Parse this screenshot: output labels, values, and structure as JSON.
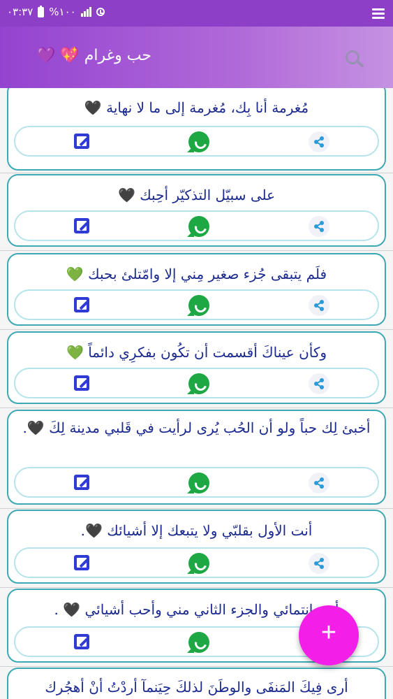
{
  "status_bar": {
    "time": "٠٣:٣٧",
    "battery_text": "%١٠٠",
    "battery_icon": "battery-full-icon",
    "signal_icon": "signal-icon",
    "alarm_icon": "alarm-icon",
    "menu_icon": "menu-icon"
  },
  "app_bar": {
    "title": "حب وغرام 💖 💜",
    "search_icon": "search-icon"
  },
  "cards": [
    {
      "text": "مُغرمة أنا بِك، مُغرمة إلى ما لا نهاية 🖤"
    },
    {
      "text": "على سبيّل التذكيّر أحِبك 🖤"
    },
    {
      "text": "فلَم يتبقى جُزء صغير مِني إلا وامّتلئ بحبك 💚"
    },
    {
      "text": "وكأن عيناكَ أقسمت أن تكُون بفكرِي دائماً 💚"
    },
    {
      "text": "أخبئ لِك حباً ولو أن الحُب يُرى لرأيت في قَلبي مدينة لِكَ 🖤."
    },
    {
      "text": "أنت الأول بقلبّي ولا يتبعك إلا أشيائك 🖤."
    },
    {
      "text": "أنت إنتمائي والجزء الثاني مني وأحب أشيائي 🖤 ."
    },
    {
      "text": "أرى فِيكَ المَنفَى والوطَنَ لذلكَ حِيَنمآ أردْتُ أنْ أهجُرك"
    }
  ],
  "actions": {
    "edit_icon": "edit-icon",
    "whatsapp_icon": "whatsapp-icon",
    "share_icon": "share-icon"
  },
  "fab": {
    "label": "+"
  },
  "colors": {
    "status_bar": "#8e3fc7",
    "app_bar_start": "#9443d0",
    "app_bar_end": "#c592e2",
    "card_border": "#3ea8b4",
    "text": "#1b2a8e",
    "fab": "#f31fe8",
    "whatsapp": "#1ea844",
    "edit": "#2f3bd4"
  }
}
